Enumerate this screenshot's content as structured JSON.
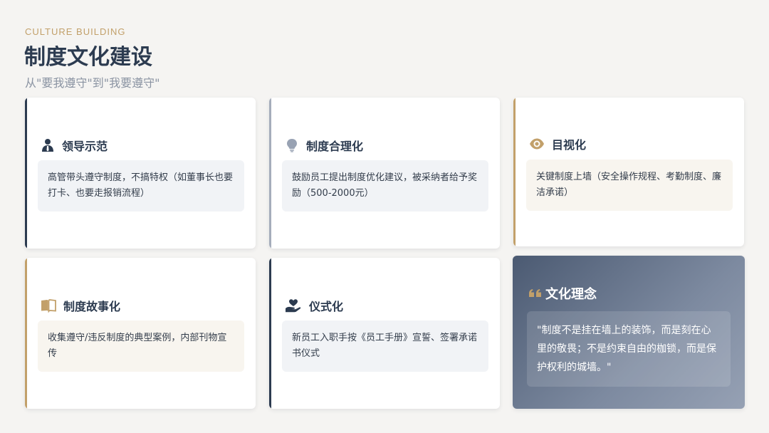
{
  "header": {
    "eyebrow": "CULTURE BUILDING",
    "title": "制度文化建设",
    "subtitle": "从\"要我遵守\"到\"我要遵守\""
  },
  "cards": [
    {
      "title": "领导示范",
      "icon": "leader-icon",
      "text": "高管带头遵守制度，不搞特权（如董事长也要打卡、也要走报销流程）"
    },
    {
      "title": "制度合理化",
      "icon": "lightbulb-icon",
      "text": "鼓励员工提出制度优化建议，被采纳者给予奖励（500-2000元）"
    },
    {
      "title": "目视化",
      "icon": "eye-icon",
      "text": "关键制度上墙（安全操作规程、考勤制度、廉洁承诺）"
    },
    {
      "title": "制度故事化",
      "icon": "book-icon",
      "text": "收集遵守/违反制度的典型案例，内部刊物宣传"
    },
    {
      "title": "仪式化",
      "icon": "hand-heart-icon",
      "text": "新员工入职手按《员工手册》宣誓、签署承诺书仪式"
    },
    {
      "title": "文化理念",
      "icon": "quote-icon",
      "text": "\"制度不是挂在墙上的装饰，而是刻在心里的敬畏；不是约束自由的枷锁，而是保护权利的城墙。\""
    }
  ],
  "colors": {
    "navy": "#2c3b50",
    "gold": "#c2a06a",
    "slate": "#a5adbb"
  }
}
